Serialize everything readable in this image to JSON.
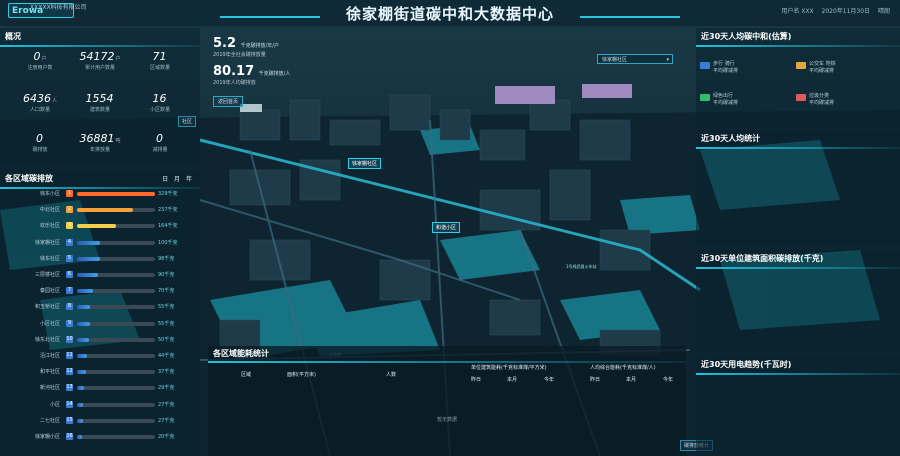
{
  "header": {
    "logo_text": "Erowa",
    "company": "XXXXX科技有限公司",
    "title": "徐家棚街道碳中和大数据中心",
    "right_items": [
      "用户名 XXX",
      "2020年11月30日",
      "晴朗"
    ]
  },
  "overview": {
    "title": "概况",
    "items": [
      {
        "value": "0",
        "unit": "户",
        "label": "注册用户数"
      },
      {
        "value": "54172",
        "unit": "户",
        "label": "累计用户数量"
      },
      {
        "value": "71",
        "unit": "",
        "label": "区域数量"
      },
      {
        "value": "6436",
        "unit": "人",
        "label": "人口数量"
      },
      {
        "value": "1554",
        "unit": "",
        "label": "建筑数量"
      },
      {
        "value": "16",
        "unit": "",
        "label": "小区数量"
      },
      {
        "value": "0",
        "unit": "",
        "label": "碳排放"
      },
      {
        "value": "36881",
        "unit": "吨",
        "label": "年排放量"
      },
      {
        "value": "0",
        "unit": "",
        "label": "减排量"
      }
    ],
    "side_tag": "社区"
  },
  "ranking": {
    "title": "各区域碳排放",
    "toggles": [
      "日",
      "月",
      "年"
    ],
    "rows": [
      {
        "rank": "1",
        "name": "徐东小区",
        "value": "329千克",
        "pct": 1.0,
        "color": "#ff6a2a"
      },
      {
        "rank": "2",
        "name": "中北社区",
        "value": "237千克",
        "pct": 0.72,
        "color": "#f4a13a"
      },
      {
        "rank": "3",
        "name": "欢乐社区",
        "value": "164千克",
        "pct": 0.5,
        "color": "#f2cf4a"
      },
      {
        "rank": "4",
        "name": "徐家棚社区",
        "value": "100千克",
        "pct": 0.3,
        "color": "#3a7bd5"
      },
      {
        "rank": "5",
        "name": "徐东社区",
        "value": "98千克",
        "pct": 0.3,
        "color": "#3a7bd5"
      },
      {
        "rank": "6",
        "name": "三层楼社区",
        "value": "90千克",
        "pct": 0.27,
        "color": "#3a7bd5"
      },
      {
        "rank": "7",
        "name": "秦园社区",
        "value": "70千克",
        "pct": 0.21,
        "color": "#3a7bd5"
      },
      {
        "rank": "8",
        "name": "积玉桥社区",
        "value": "55千克",
        "pct": 0.17,
        "color": "#3a7bd5"
      },
      {
        "rank": "9",
        "name": "小区社区",
        "value": "55千克",
        "pct": 0.17,
        "color": "#3a7bd5"
      },
      {
        "rank": "10",
        "name": "徐东北社区",
        "value": "50千克",
        "pct": 0.15,
        "color": "#3a7bd5"
      },
      {
        "rank": "11",
        "name": "沿江社区",
        "value": "44千克",
        "pct": 0.13,
        "color": "#3a7bd5"
      },
      {
        "rank": "12",
        "name": "和平社区",
        "value": "37千克",
        "pct": 0.11,
        "color": "#3a7bd5"
      },
      {
        "rank": "13",
        "name": "新河社区",
        "value": "29千克",
        "pct": 0.09,
        "color": "#3a7bd5"
      },
      {
        "rank": "14",
        "name": "小区",
        "value": "27千克",
        "pct": 0.08,
        "color": "#3a7bd5"
      },
      {
        "rank": "15",
        "name": "二七社区",
        "value": "27千克",
        "pct": 0.08,
        "color": "#3a7bd5"
      },
      {
        "rank": "16",
        "name": "徐家棚小区",
        "value": "20千克",
        "pct": 0.06,
        "color": "#3a7bd5"
      }
    ]
  },
  "center_stats": {
    "stat1_value": "5.2",
    "stat1_unit": "千克碳排放/年/户",
    "stat1_sub": "2019年全社会碳排放量",
    "stat2_value": "80.17",
    "stat2_unit": "千克碳排放/人",
    "stat2_sub": "2019年人均碳排放",
    "button": "返回首页",
    "select": "徐家棚社区"
  },
  "map_labels": {
    "label1": "徐家棚社区",
    "label2": "和谐小区",
    "road1": "1号线",
    "road2": "1号线武昌火车站"
  },
  "table": {
    "title": "各区域能耗统计",
    "headers": [
      "区域",
      "面积(平方米)",
      "人数"
    ],
    "group1": "单位建筑能耗(千克标准煤/平方米)",
    "group2": "人均综合能耗(千克标准煤/人)",
    "sub_headers": [
      "昨日",
      "本月",
      "今年"
    ],
    "empty": "暂无数据",
    "bottom_btn": "碳排放统计"
  },
  "right_panels": {
    "p1_title": "近30天人均碳中和(估算)",
    "p1_items": [
      {
        "label": "步行 骑行",
        "sub": "平均碳减排"
      },
      {
        "label": "公交车 地铁",
        "sub": "平均碳减排"
      },
      {
        "label": "绿色出行",
        "sub": "平均碳减排"
      },
      {
        "label": "垃圾分类",
        "sub": "平均碳减排"
      }
    ],
    "p2_title": "近30天人均统计",
    "p3_title": "近30天单位建筑面积碳排放(千克)",
    "p4_title": "近30天用电趋势(千瓦时)"
  },
  "colors": {
    "accent": "#22c3df",
    "panel": "#0a222e"
  }
}
